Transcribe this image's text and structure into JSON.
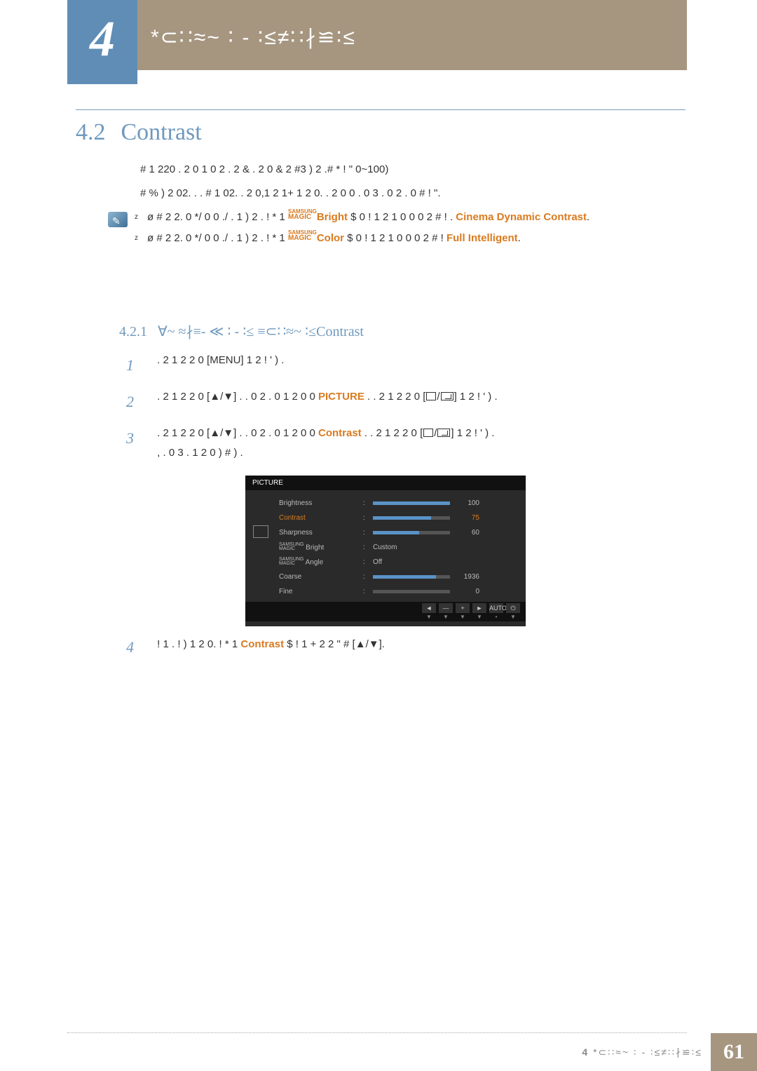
{
  "chapter": {
    "num": "4",
    "title": "*⊂∷≈~  ∶ -  ∶≤≠∷∤≌∶≤"
  },
  "section": {
    "num": "4.2",
    "title": "Contrast"
  },
  "intro": {
    "p1": "#     1 220 .  2   0 1 0 2 .  2 & .  2   0     & 2 #3 )  2 .#   * !  \" 0~100)",
    "p2": "# %    ) 2 02.     . . #    1 02.   .  2    0,1 2 1+ 1 2 0. .  2   0   0 . 0  3 .     0 2 . 0 #  !     \"."
  },
  "notes": {
    "n1a": "ø # 2 2.   0   */ 0  0    ./ .   1   ) 2 .   ! *     1",
    "n1b": "  $ 0 !   1  2 1 0 0   0  2  # !     .",
    "n1_brand1": "Bright",
    "n1_brand2": "Cinema",
    "n1_brand3": "Dynamic Contrast",
    "n2a": "ø # 2 2.   0   */ 0  0    ./ .   1   ) 2 .   ! *     1",
    "n2b": "  $ 0 !   1  2 1 0 0  0  2   # !",
    "n2_brand1": "Color",
    "n2_brand2": "Full",
    "n2_brand3": "Intelligent"
  },
  "subsec": {
    "num": "4.2.1",
    "title": "∀~ ≈∤≡-  ≪    ∶ -  ∶≤ ≡⊂∷≈~  ∶≤",
    "suffix": "Contrast"
  },
  "steps": {
    "s1": ". 2  1 2 2 0 [",
    "s1_key": "MENU",
    "s1_end": "]  1 2   !  ' ) .",
    "s2a": ". 2  1 2 2 0 [▲/▼]   . .  0 2 .     0 1 2 0 0     ",
    "s2_brand": "PICTURE",
    "s2b": "   . . 2  1 2 2 0 [",
    "s2c": "]  1 2  !  ' ) .",
    "s3a": ". 2  1 2 2 0 [▲/▼]   . .  0 2 .     0 1 2 0 0     ",
    "s3_brand": "Contrast",
    "s3b": "   . . 2  1 2 2 0 [",
    "s3c": "]  1 2  !  ' ) .",
    "s3d": ", . 0  3 .   1 2 0 )  #     ) .",
    "s4a": "!  1 . !  ) 1 2 0.  ! *     1",
    "s4_brand": "Contrast",
    "s4b": "$ !  1        + 2 2 \"   #    [▲/▼]."
  },
  "osd": {
    "title": "PICTURE",
    "rows": [
      {
        "label": "Brightness",
        "bar": 100,
        "val": "100"
      },
      {
        "label": "Contrast",
        "bar": 75,
        "val": "75",
        "selected": true
      },
      {
        "label": "Sharpness",
        "bar": 60,
        "val": "60"
      },
      {
        "label": "MAGIC Bright",
        "text": "Custom",
        "small": "SAMSUNG"
      },
      {
        "label": "MAGIC Angle",
        "text": "Off",
        "small": "SAMSUNG"
      },
      {
        "label": "Coarse",
        "bar": 82,
        "val": "1936"
      },
      {
        "label": "Fine",
        "bar": 0,
        "val": "0"
      }
    ],
    "foot_keys": [
      "◄",
      "—",
      "+",
      "►",
      "AUTO",
      "⏻"
    ],
    "foot_subs": [
      "▼",
      "▼",
      "▼",
      "▼",
      "•",
      "▼"
    ]
  },
  "footer": {
    "chapnum": "4",
    "chaptxt": "*⊂∷≈~  ∶ -  ∶≤≠∷∤≌∶≤",
    "page": "61"
  }
}
